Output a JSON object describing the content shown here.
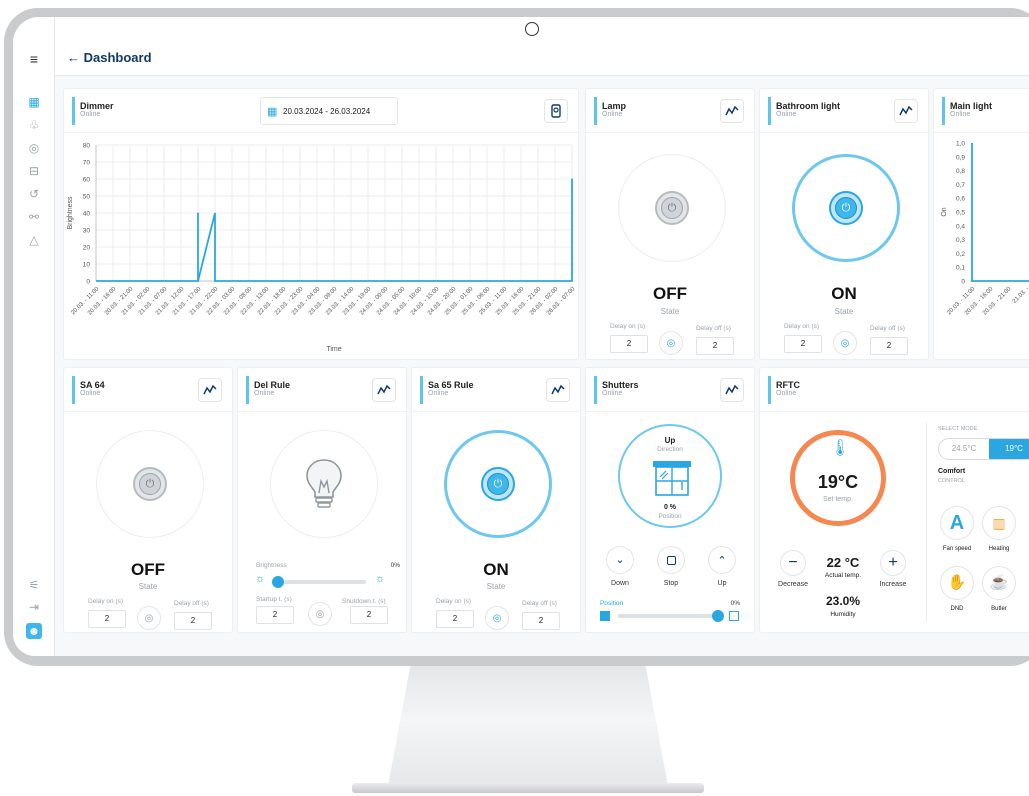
{
  "nav": {
    "back_label": "← Dashboard"
  },
  "dimmer": {
    "title": "Dimmer",
    "status": "Online",
    "date_range": "20.03.2024 - 26.03.2024",
    "chart_data": {
      "type": "line",
      "xlabel": "Time",
      "ylabel": "Brightness",
      "ylim": [
        0,
        80
      ],
      "yticks": [
        0,
        10,
        20,
        30,
        40,
        50,
        60,
        70,
        80
      ],
      "x": [
        "20.03. - 11:00",
        "20.03. - 16:00",
        "20.03. - 21:00",
        "21.03. - 02:00",
        "21.03. - 07:00",
        "21.03. - 12:00",
        "21.03. - 17:00",
        "21.03. - 22:00",
        "22.03. - 03:00",
        "22.03. - 08:00",
        "22.03. - 13:00",
        "22.03. - 18:00",
        "22.03. - 23:00",
        "23.03. - 04:00",
        "23.03. - 09:00",
        "23.03. - 14:00",
        "23.03. - 19:00",
        "24.03. - 00:00",
        "24.03. - 05:00",
        "24.03. - 10:00",
        "24.03. - 15:00",
        "24.03. - 20:00",
        "25.03. - 01:00",
        "25.03. - 06:00",
        "25.03. - 11:00",
        "25.03. - 16:00",
        "25.03. - 21:00",
        "26.03. - 02:00",
        "26.03. - 07:00"
      ],
      "series": [
        {
          "values": [
            0,
            0,
            0,
            0,
            0,
            0,
            40,
            0,
            0,
            0,
            0,
            0,
            0,
            0,
            0,
            0,
            0,
            0,
            0,
            0,
            0,
            0,
            0,
            0,
            0,
            0,
            0,
            0,
            60
          ]
        }
      ],
      "grid": true,
      "color": "#29a8e0"
    }
  },
  "lamp": {
    "title": "Lamp",
    "status": "Online",
    "state": "OFF",
    "state_label": "State",
    "delay_on_label": "Delay on (s)",
    "delay_on": "2",
    "delay_off_label": "Delay off (s)",
    "delay_off": "2"
  },
  "bathroom": {
    "title": "Bathroom light",
    "status": "Online",
    "state": "ON",
    "state_label": "State",
    "delay_on_label": "Delay on (s)",
    "delay_on": "2",
    "delay_off_label": "Delay off (s)",
    "delay_off": "2"
  },
  "mainlight": {
    "title": "Main light",
    "status": "Online",
    "chart_data": {
      "type": "line",
      "ylabel": "On",
      "ylim": [
        0,
        1.0
      ],
      "yticks": [
        "1,0",
        "0,9",
        "0,8",
        "0,7",
        "0,6",
        "0,5",
        "0,4",
        "0,3",
        "0,2",
        "0,1",
        "0"
      ],
      "x": [
        "20.03. - 11:00",
        "20.03. - 16:00",
        "20.03. - 21:00",
        "21.03. -"
      ],
      "series": [
        {
          "values": [
            1,
            0,
            0,
            0
          ]
        }
      ]
    }
  },
  "sa64": {
    "title": "SA 64",
    "status": "Online",
    "state": "OFF",
    "state_label": "State",
    "delay_on_label": "Delay on (s)",
    "delay_on": "2",
    "delay_off_label": "Delay off (s)",
    "delay_off": "2"
  },
  "delrule": {
    "title": "Del Rule",
    "status": "Online",
    "brightness_label": "Brightness",
    "brightness_value": "0%",
    "brightness_level": 0.0,
    "startup_label": "Startup t. (s)",
    "startup": "2",
    "shutdown_label": "Shutdown t. (s)",
    "shutdown": "2"
  },
  "sa65": {
    "title": "Sa 65 Rule",
    "status": "Online",
    "state": "ON",
    "state_label": "State",
    "delay_on_label": "Delay on (s)",
    "delay_on": "2",
    "delay_off_label": "Delay off (s)",
    "delay_off": "2"
  },
  "shutters": {
    "title": "Shutters",
    "status": "Online",
    "direction": "Up",
    "direction_label": "Direction",
    "position": "0 %",
    "position_label": "Position",
    "down_label": "Down",
    "stop_label": "Stop",
    "up_label": "Up",
    "slider_label": "Position",
    "slider_value": "0%",
    "slider_level": 1.0
  },
  "rftc": {
    "title": "RFTC",
    "status": "Online",
    "set_temp": "19°C",
    "set_temp_label": "Set temp.",
    "decrease_label": "Decrease",
    "increase_label": "Increase",
    "actual_temp": "22 °C",
    "actual_temp_label": "Actual temp.",
    "humidity": "23.0%",
    "humidity_label": "Humidity",
    "select_mode_label": "SELECT MODE",
    "mode_a": "24.5°C",
    "mode_b": "19°C",
    "mode_name": "Comfort",
    "control_label": "CONTROL",
    "controls": [
      {
        "label": "Fan speed",
        "icon": "fan-speed-icon"
      },
      {
        "label": "Heating",
        "icon": "radiator-icon"
      },
      {
        "label": "DND",
        "icon": "hand-icon"
      },
      {
        "label": "Butler",
        "icon": "butler-icon"
      }
    ],
    "accent": "#f5874f"
  }
}
